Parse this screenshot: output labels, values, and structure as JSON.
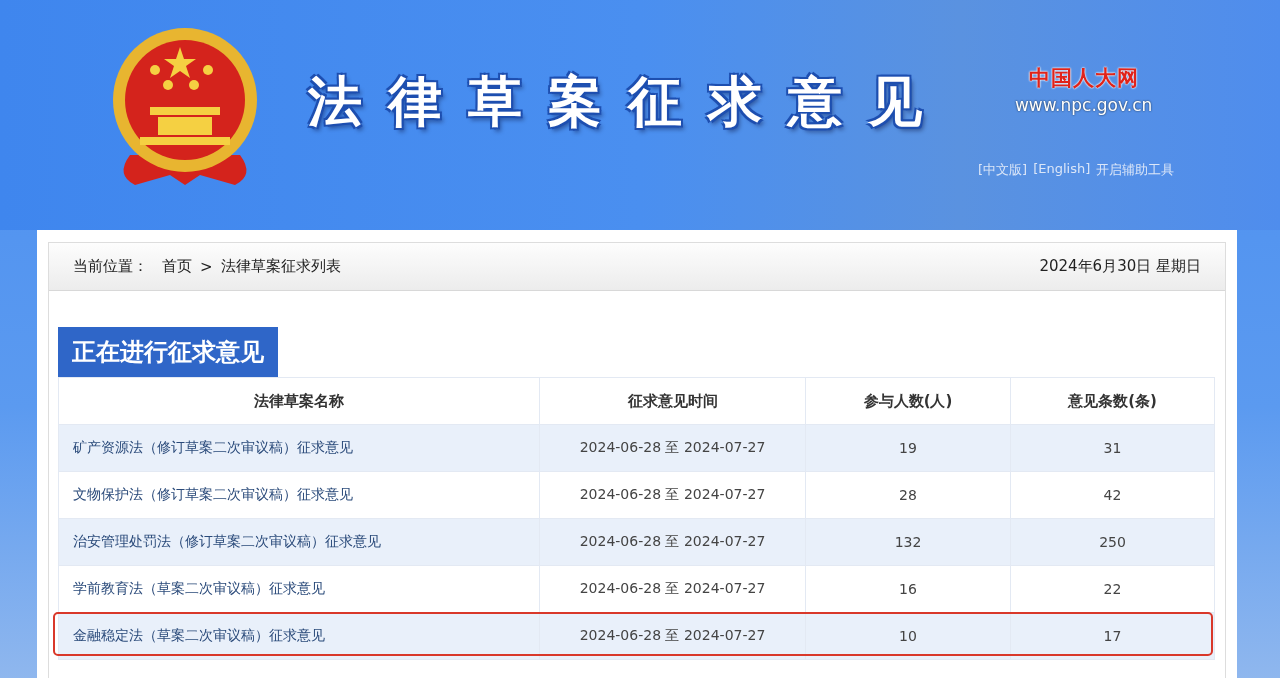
{
  "header": {
    "title": "法律草案征求意见",
    "site_logo": "中国人大网",
    "site_url": "www.npc.gov.cn",
    "links": [
      "[中文版]",
      "[English]",
      "开启辅助工具"
    ]
  },
  "breadcrumb": {
    "label": "当前位置：",
    "items": [
      "首页",
      "法律草案征求列表"
    ],
    "separator": ">"
  },
  "date": "2024年6月30日 星期日",
  "section_title": "正在进行征求意见",
  "table": {
    "columns": [
      "法律草案名称",
      "征求意见时间",
      "参与人数(人)",
      "意见条数(条)"
    ],
    "rows": [
      {
        "name": "矿产资源法（修订草案二次审议稿）征求意见",
        "period": "2024-06-28 至 2024-07-27",
        "participants": "19",
        "comments": "31",
        "highlighted": false
      },
      {
        "name": "文物保护法（修订草案二次审议稿）征求意见",
        "period": "2024-06-28 至 2024-07-27",
        "participants": "28",
        "comments": "42",
        "highlighted": false
      },
      {
        "name": "治安管理处罚法（修订草案二次审议稿）征求意见",
        "period": "2024-06-28 至 2024-07-27",
        "participants": "132",
        "comments": "250",
        "highlighted": false
      },
      {
        "name": "学前教育法（草案二次审议稿）征求意见",
        "period": "2024-06-28 至 2024-07-27",
        "participants": "16",
        "comments": "22",
        "highlighted": false
      },
      {
        "name": "金融稳定法（草案二次审议稿）征求意见",
        "period": "2024-06-28 至 2024-07-27",
        "participants": "10",
        "comments": "17",
        "highlighted": true
      }
    ]
  }
}
